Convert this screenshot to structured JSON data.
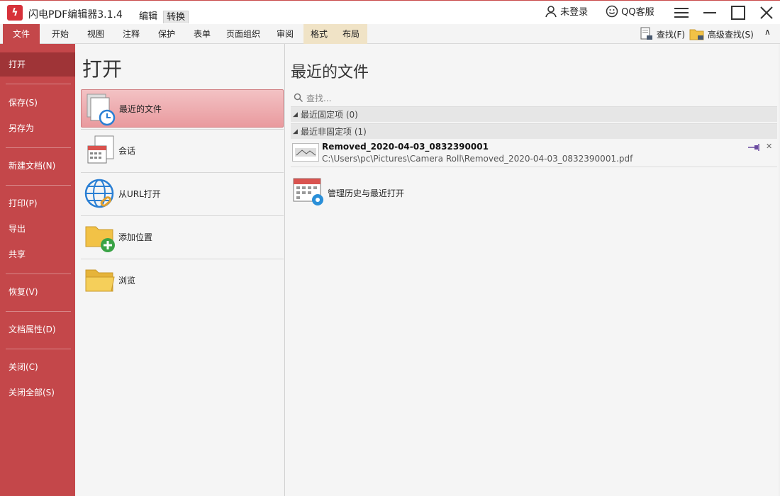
{
  "app": {
    "title": "闪电PDF编辑器3.1.4",
    "mode_tabs": {
      "edit": "编辑",
      "convert": "转换"
    },
    "login": "未登录",
    "support": "QQ客服"
  },
  "ribbon": {
    "tabs": [
      "文件",
      "开始",
      "视图",
      "注释",
      "保护",
      "表单",
      "页面组织",
      "审阅",
      "格式",
      "布局"
    ],
    "find": "查找(F)",
    "advanced_find": "高级查找(S)",
    "collapse": "∧"
  },
  "file_menu": {
    "items": [
      "打开",
      "保存(S)",
      "另存为",
      "新建文档(N)",
      "打印(P)",
      "导出",
      "共享",
      "恢复(V)",
      "文档属性(D)",
      "关闭(C)",
      "关闭全部(S)"
    ]
  },
  "open_panel": {
    "title": "打开",
    "items": [
      "最近的文件",
      "会话",
      "从URL打开",
      "添加位置",
      "浏览"
    ]
  },
  "recent": {
    "title": "最近的文件",
    "search_placeholder": "查找...",
    "pinned_header": "最近固定项 (0)",
    "unpinned_header": "最近非固定项 (1)",
    "file_name": "Removed_2020-04-03_0832390001",
    "file_path": "C:\\Users\\pc\\Pictures\\Camera Roll\\Removed_2020-04-03_0832390001.pdf",
    "manage_label": "管理历史与最近打开"
  },
  "colors": {
    "accent": "#c4474a",
    "accent_dark": "#9f3437",
    "selected_item": "#e99a9e"
  }
}
